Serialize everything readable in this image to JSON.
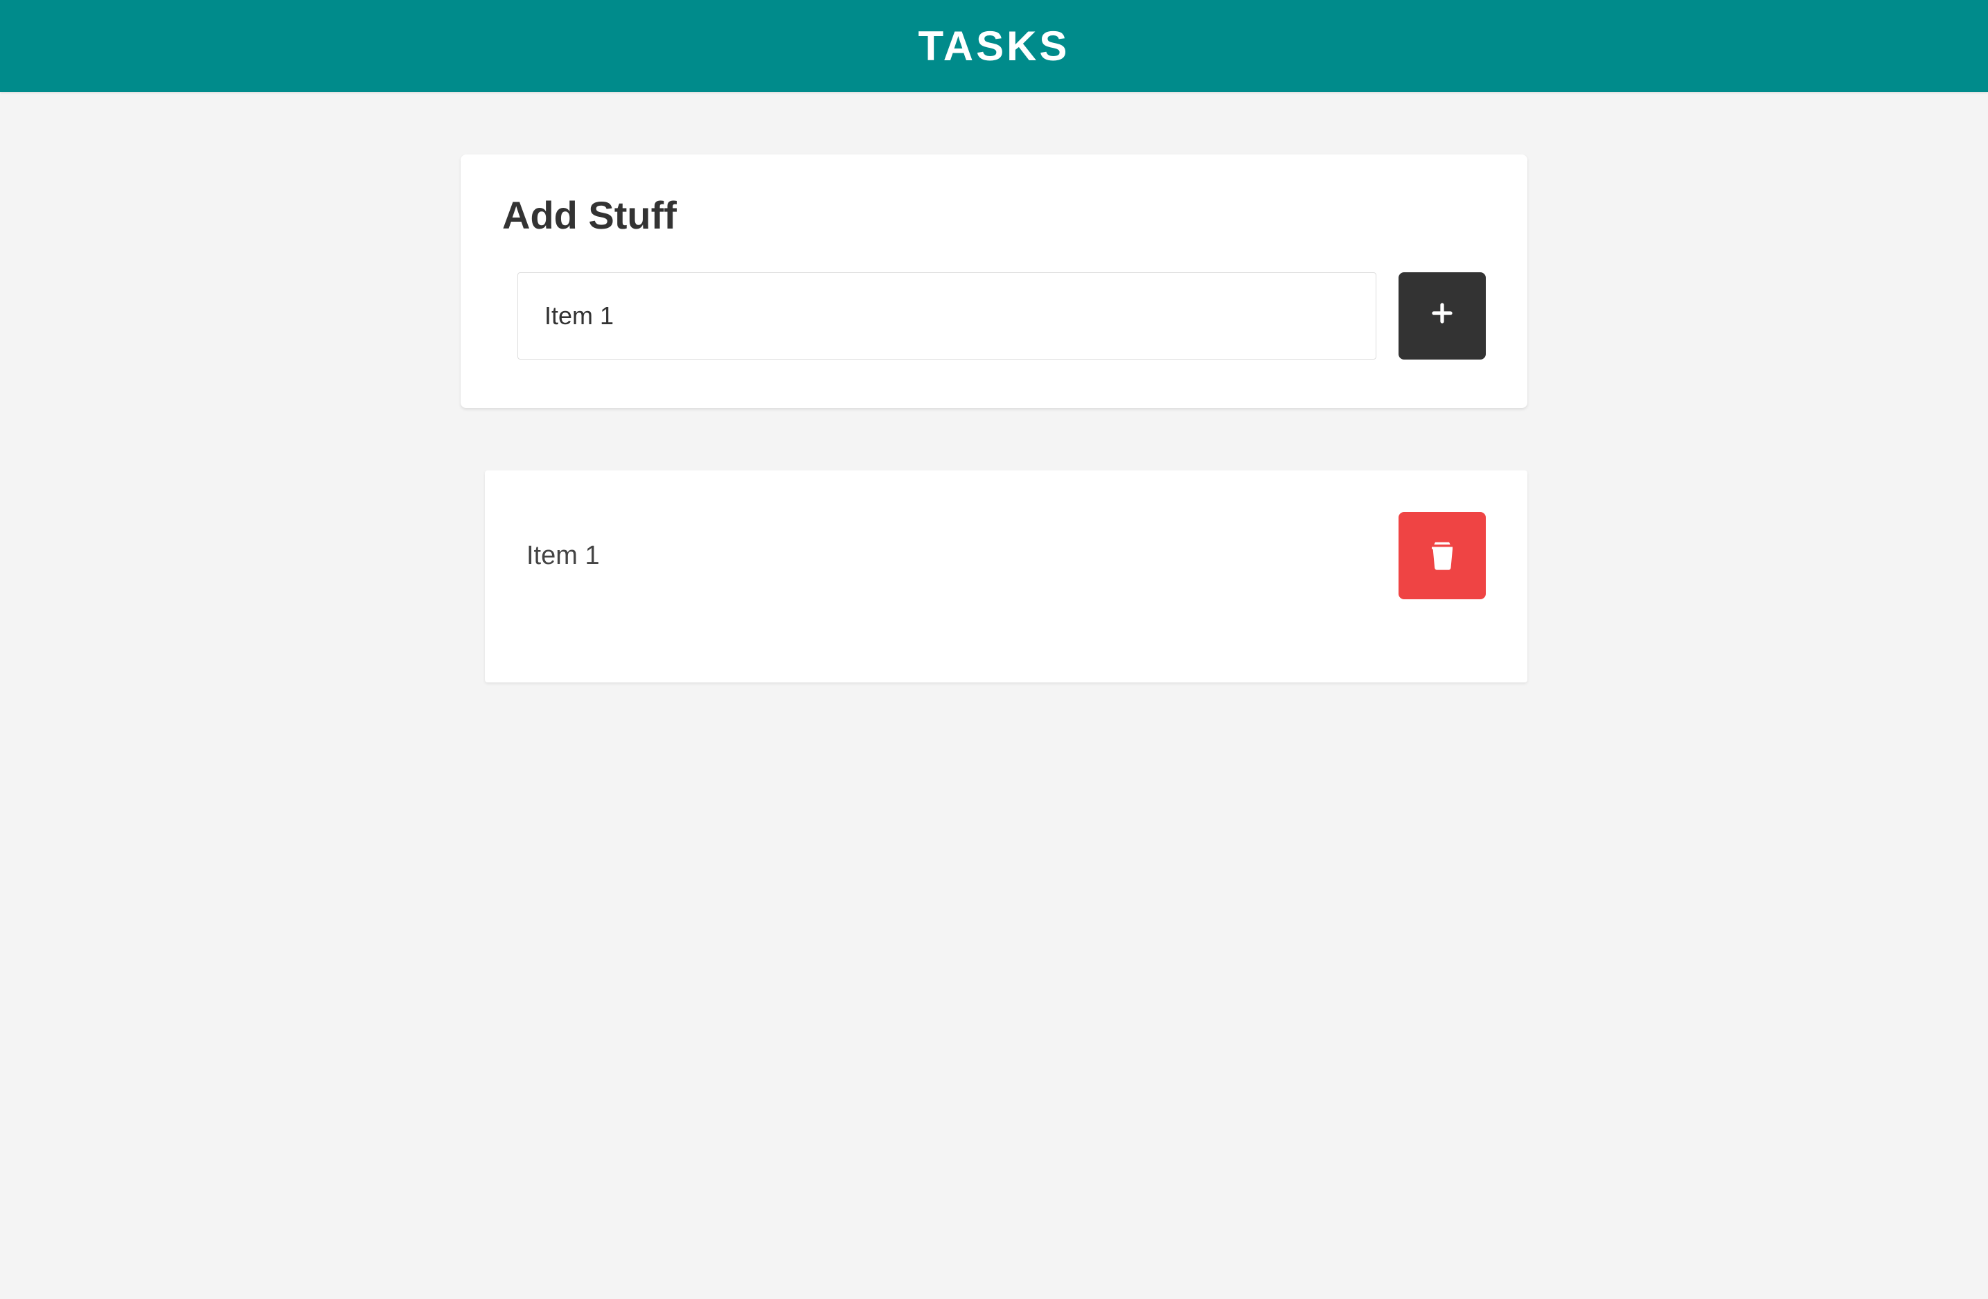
{
  "header": {
    "title": "TASKS"
  },
  "form": {
    "heading": "Add Stuff",
    "input_value": "Item 1"
  },
  "items": [
    {
      "label": "Item 1"
    }
  ]
}
